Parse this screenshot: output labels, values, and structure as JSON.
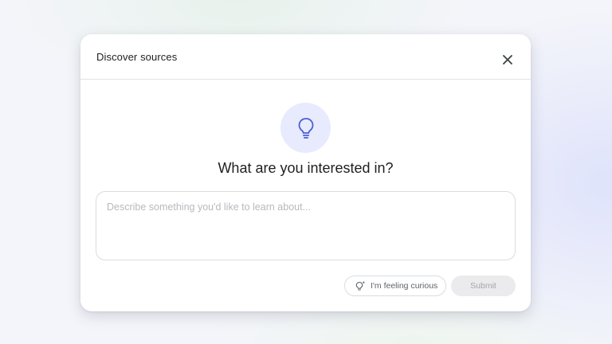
{
  "dialog": {
    "title": "Discover sources",
    "close_icon": "close-icon",
    "hero_icon": "lightbulb-icon",
    "question": "What are you interested in?",
    "input": {
      "placeholder": "Describe something you'd like to learn about...",
      "value": ""
    },
    "curious_button": {
      "icon": "sparkle-lightbulb-icon",
      "label": "I'm feeling curious"
    },
    "submit_button": {
      "label": "Submit",
      "disabled": true
    }
  },
  "colors": {
    "accent": "#4a5fd6",
    "hero_circle": "#e7ebfd",
    "submit_disabled_bg": "#ebebed",
    "submit_disabled_text": "#a4a6aa"
  }
}
